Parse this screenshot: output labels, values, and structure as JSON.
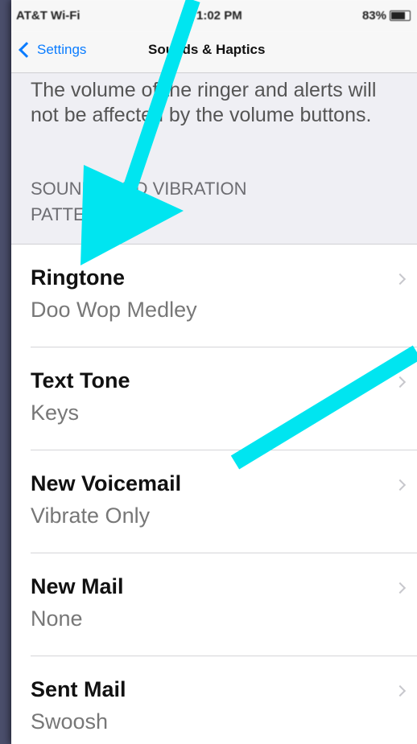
{
  "status_bar": {
    "carrier": "AT&T Wi-Fi",
    "time": "1:02 PM",
    "battery": "83%"
  },
  "nav": {
    "back_label": "Settings",
    "title": "Sounds & Haptics"
  },
  "section": {
    "footer_text": "The volume of the ringer and alerts will not be affected by the volume buttons.",
    "title": "SOUNDS AND VIBRATION PATTERNS"
  },
  "rows": [
    {
      "title": "Ringtone",
      "value": "Doo Wop Medley"
    },
    {
      "title": "Text Tone",
      "value": "Keys"
    },
    {
      "title": "New Voicemail",
      "value": "Vibrate Only"
    },
    {
      "title": "New Mail",
      "value": "None"
    },
    {
      "title": "Sent Mail",
      "value": "Swoosh"
    }
  ],
  "colors": {
    "accent": "#0a7cff",
    "annotation_arrow": "#00e5f0"
  },
  "icons": {
    "back": "chevron-left-icon",
    "disclosure": "chevron-right-icon",
    "battery": "battery-icon",
    "wifi": "wifi-icon",
    "annotation": "arrow-icon"
  }
}
